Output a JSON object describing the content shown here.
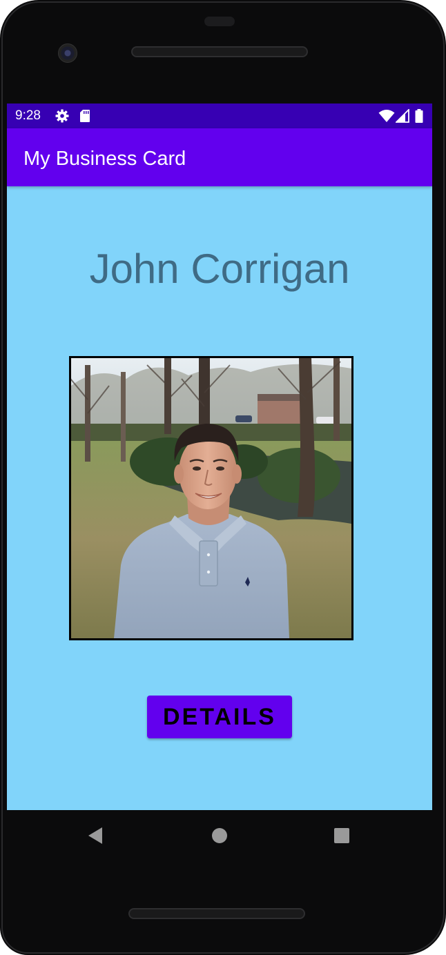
{
  "status_bar": {
    "time": "9:28",
    "icons": [
      "gear-icon",
      "sd-card-icon",
      "wifi-icon",
      "signal-icon",
      "battery-icon"
    ]
  },
  "app_bar": {
    "title": "My Business Card"
  },
  "card": {
    "name": "John Corrigan",
    "photo": "profile-photo",
    "button_label": "DETAILS"
  },
  "nav_bar": {
    "icons": [
      "back-icon",
      "home-icon",
      "recents-icon"
    ]
  },
  "colors": {
    "status_bar": "#3700b3",
    "app_bar": "#6200ee",
    "background": "#81d4fa",
    "name_text": "#3f6b85",
    "button": "#6200ee",
    "button_text": "#000000"
  }
}
